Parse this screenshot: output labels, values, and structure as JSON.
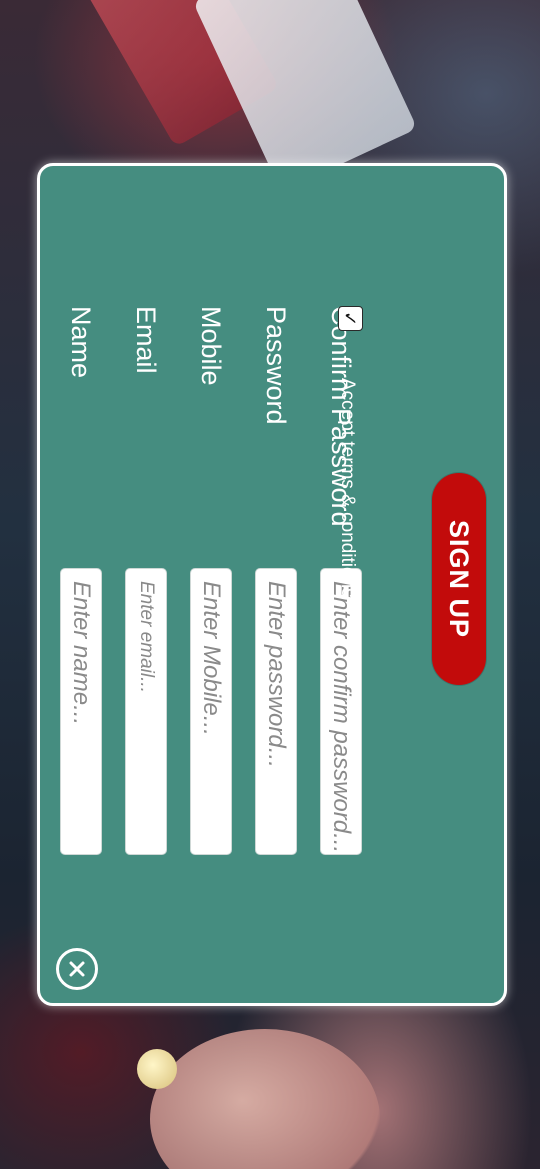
{
  "form": {
    "fields": [
      {
        "label": "Name",
        "placeholder": "Enter name..."
      },
      {
        "label": "Email",
        "placeholder": "Enter email..."
      },
      {
        "label": "Mobile",
        "placeholder": "Enter Mobile..."
      },
      {
        "label": "Password",
        "placeholder": "Enter password..."
      },
      {
        "label": "Confirm Password",
        "placeholder": "Enter confirm password..."
      }
    ],
    "terms": {
      "checkmark": "✓",
      "label": "Accept terms & conditions"
    },
    "submit_label": "SIGN UP"
  },
  "icons": {
    "close": "close-icon"
  },
  "colors": {
    "panel": "#458d80",
    "button": "#c20b0b",
    "border": "#ffffff"
  }
}
